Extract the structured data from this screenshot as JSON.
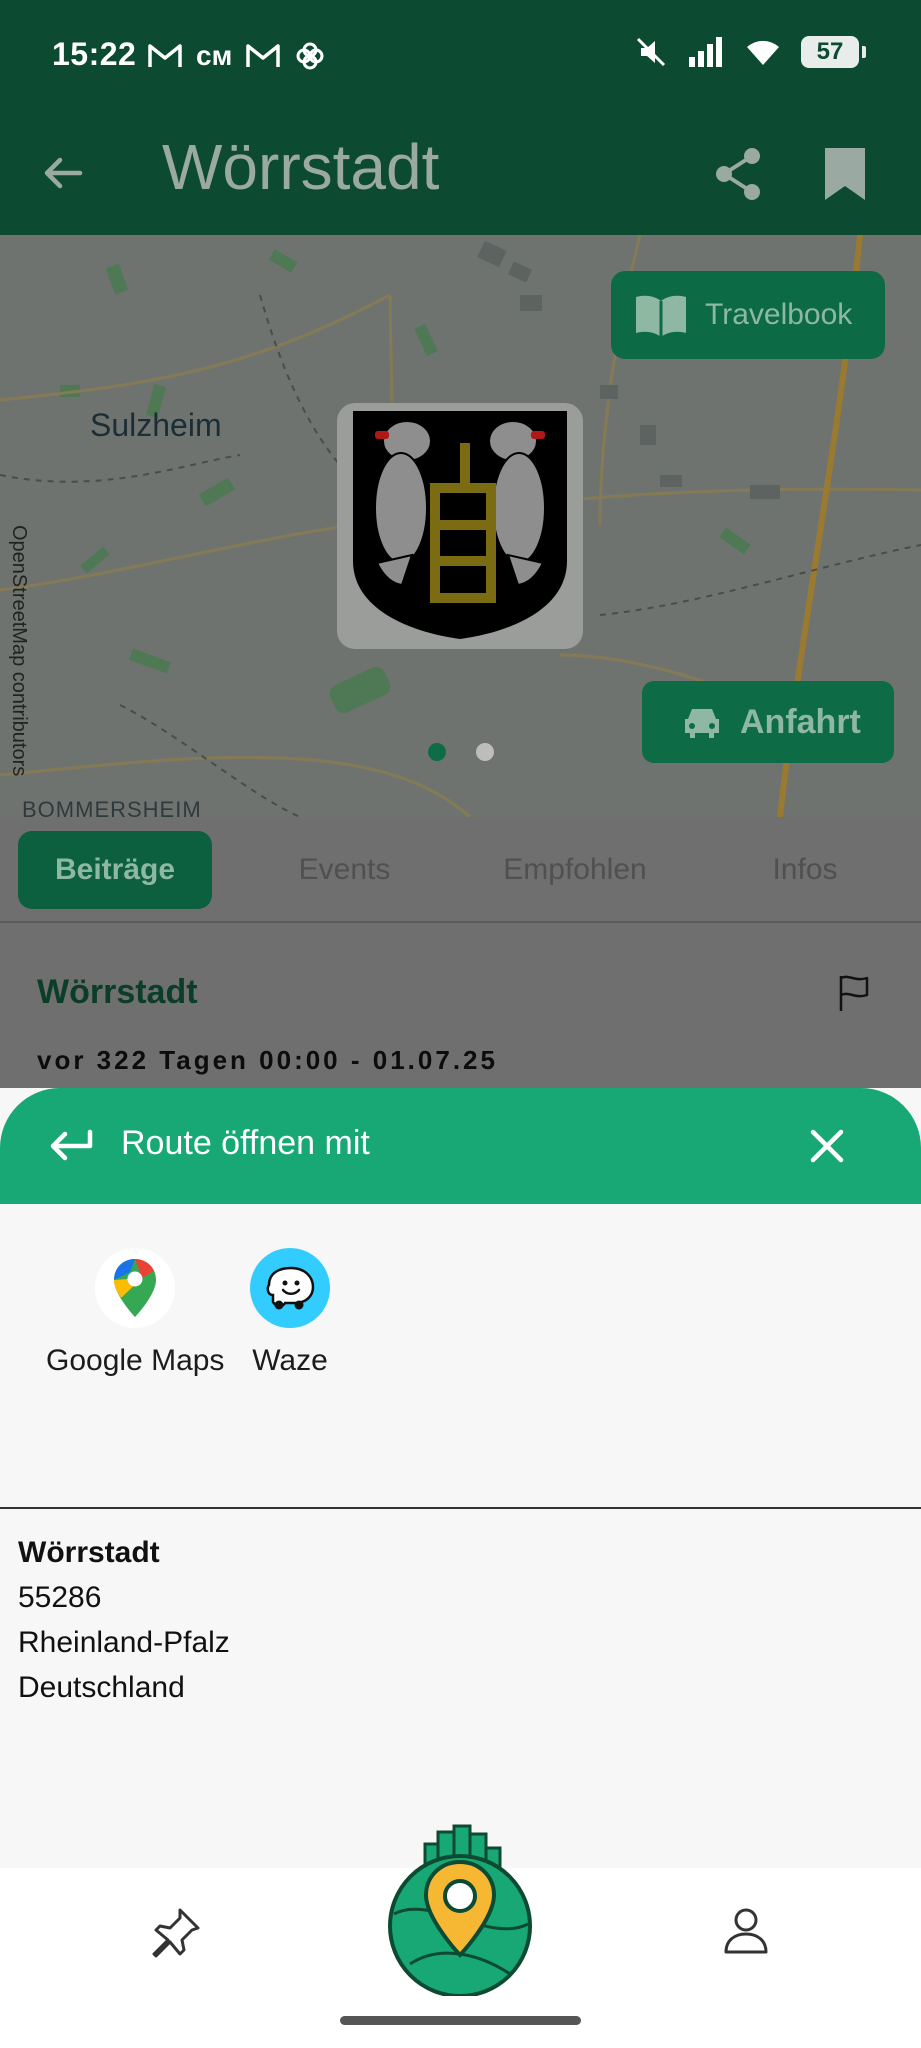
{
  "status_bar": {
    "time": "15:22",
    "notif_icons": [
      "gmail-icon",
      "carrier-icon",
      "gmail-icon",
      "pinwheel-icon"
    ],
    "battery": "57"
  },
  "app_bar": {
    "title": "Wörrstadt",
    "back_icon": "arrow-left-icon",
    "share_icon": "share-icon",
    "bookmark_icon": "bookmark-icon"
  },
  "map": {
    "attribution": "OpenStreetMap contributors",
    "place_label": "Sulzheim",
    "place_label_2": "BOMMERSHEIM",
    "travelbook_label": "Travelbook",
    "directions_label": "Anfahrt",
    "carousel_active_index": 0,
    "carousel_count": 2
  },
  "tabs": [
    {
      "label": "Beiträge",
      "active": true
    },
    {
      "label": "Events",
      "active": false
    },
    {
      "label": "Empfohlen",
      "active": false
    },
    {
      "label": "Infos",
      "active": false
    }
  ],
  "post": {
    "title": "Wörrstadt",
    "date": "vor 322 Tagen 00:00 - 01.07.25"
  },
  "sheet": {
    "title": "Route öffnen mit",
    "apps": [
      {
        "label": "Google Maps",
        "icon": "google-maps-icon"
      },
      {
        "label": "Waze",
        "icon": "waze-icon"
      }
    ]
  },
  "address": {
    "name": "Wörrstadt",
    "postal_code": "55286",
    "region": "Rheinland-Pfalz",
    "country": "Deutschland"
  },
  "colors": {
    "brand_dark": "#0c4a32",
    "sheet_green": "#17a876",
    "tab_active": "#0c5f3f"
  }
}
